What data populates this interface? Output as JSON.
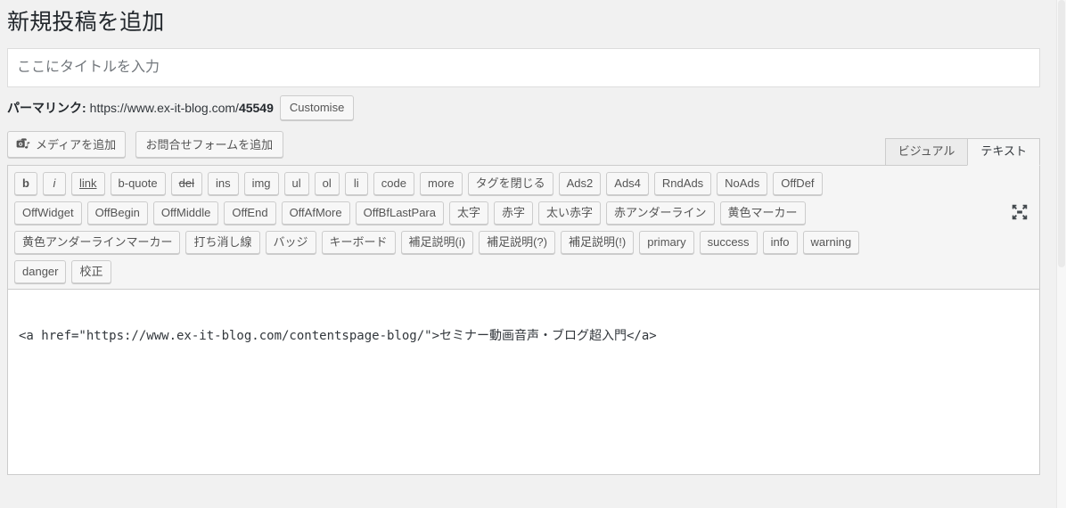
{
  "page": {
    "title": "新規投稿を追加"
  },
  "title_field": {
    "name": "post-title",
    "value": "",
    "placeholder": "ここにタイトルを入力"
  },
  "permalink": {
    "label": "パーマリンク:",
    "url": "https://www.ex-it-blog.com/",
    "slug": "45549",
    "customise_label": "Customise"
  },
  "media_bar": {
    "add_media_label": "メディアを追加",
    "add_media_icon": "media-icon",
    "add_form_label": "お問合せフォームを追加"
  },
  "tabs": {
    "visual": "ビジュアル",
    "text": "テキスト",
    "active": "text"
  },
  "dfw": {
    "icon": "fullscreen-expand-icon"
  },
  "quicktags": {
    "rows": [
      [
        {
          "label": "b",
          "style": "s-bold"
        },
        {
          "label": "i",
          "style": "s-italic"
        },
        {
          "label": "link",
          "style": "s-underline"
        },
        {
          "label": "b-quote",
          "style": ""
        },
        {
          "label": "del",
          "style": "s-strike"
        },
        {
          "label": "ins",
          "style": ""
        },
        {
          "label": "img",
          "style": ""
        },
        {
          "label": "ul",
          "style": ""
        },
        {
          "label": "ol",
          "style": ""
        },
        {
          "label": "li",
          "style": ""
        },
        {
          "label": "code",
          "style": ""
        },
        {
          "label": "more",
          "style": ""
        },
        {
          "label": "タグを閉じる",
          "style": ""
        },
        {
          "label": "Ads2",
          "style": ""
        },
        {
          "label": "Ads4",
          "style": ""
        },
        {
          "label": "RndAds",
          "style": ""
        },
        {
          "label": "NoAds",
          "style": ""
        },
        {
          "label": "OffDef",
          "style": ""
        }
      ],
      [
        {
          "label": "OffWidget",
          "style": ""
        },
        {
          "label": "OffBegin",
          "style": ""
        },
        {
          "label": "OffMiddle",
          "style": ""
        },
        {
          "label": "OffEnd",
          "style": ""
        },
        {
          "label": "OffAfMore",
          "style": ""
        },
        {
          "label": "OffBfLastPara",
          "style": ""
        },
        {
          "label": "太字",
          "style": ""
        },
        {
          "label": "赤字",
          "style": ""
        },
        {
          "label": "太い赤字",
          "style": ""
        },
        {
          "label": "赤アンダーライン",
          "style": ""
        },
        {
          "label": "黄色マーカー",
          "style": ""
        }
      ],
      [
        {
          "label": "黄色アンダーラインマーカー",
          "style": ""
        },
        {
          "label": "打ち消し線",
          "style": ""
        },
        {
          "label": "バッジ",
          "style": ""
        },
        {
          "label": "キーボード",
          "style": ""
        },
        {
          "label": "補足説明(i)",
          "style": ""
        },
        {
          "label": "補足説明(?)",
          "style": ""
        },
        {
          "label": "補足説明(!)",
          "style": ""
        },
        {
          "label": "primary",
          "style": ""
        },
        {
          "label": "success",
          "style": ""
        },
        {
          "label": "info",
          "style": ""
        },
        {
          "label": "warning",
          "style": ""
        }
      ],
      [
        {
          "label": "danger",
          "style": ""
        },
        {
          "label": "校正",
          "style": ""
        }
      ]
    ]
  },
  "editor": {
    "content": "<a href=\"https://www.ex-it-blog.com/contentspage-blog/\">セミナー動画音声・ブログ超入門</a>"
  },
  "colors": {
    "page_bg": "#f1f1f1",
    "panel_bg": "#f5f5f5",
    "button_bg": "#f7f7f7",
    "border": "#cccccc",
    "text": "#32373c",
    "heading": "#23282d"
  }
}
